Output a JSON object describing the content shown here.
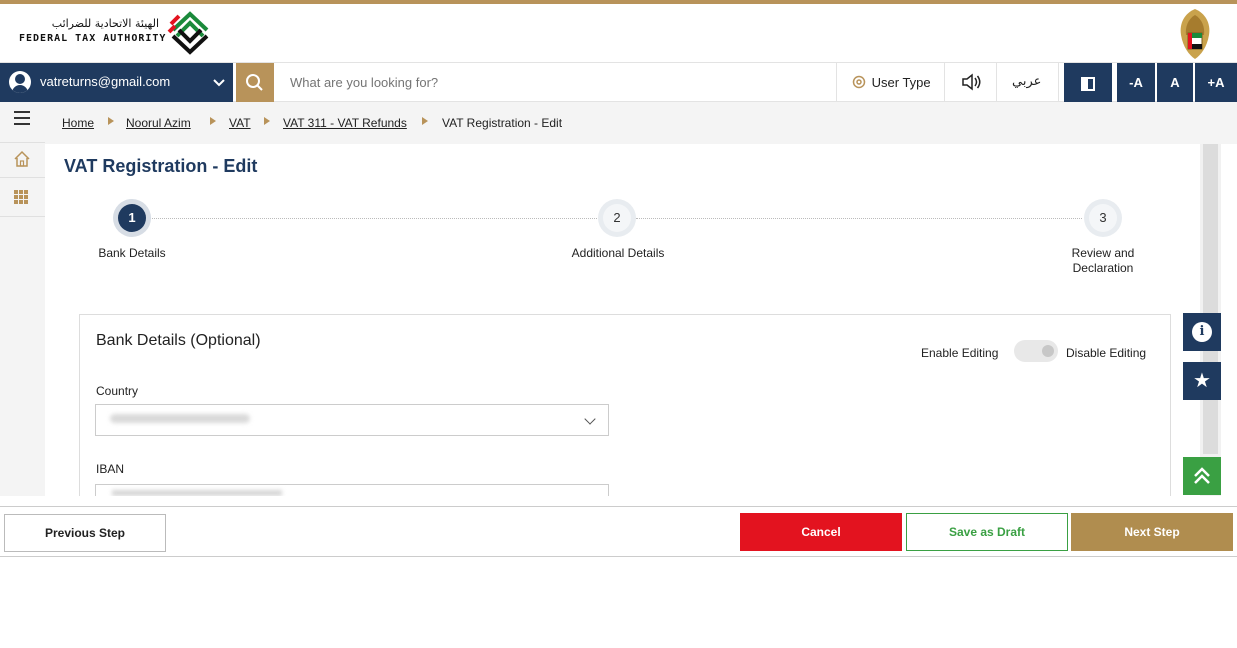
{
  "header": {
    "org_name_ar": "الهيئة الاتحادية للضرائب",
    "org_name_en": "FEDERAL TAX AUTHORITY",
    "logo_icon": "fta-logo-icon",
    "emblem_icon": "uae-emblem-icon"
  },
  "navbar": {
    "user_email": "vatreturns@gmail.com",
    "search_placeholder": "What are you looking for?",
    "user_type_label": "User Type",
    "arabic_label": "عربي",
    "decrease_font": "-A",
    "normal_font": "A",
    "increase_font": "+A"
  },
  "breadcrumb": {
    "items": [
      {
        "label": "Home"
      },
      {
        "label": "Noorul Azim"
      },
      {
        "label": "VAT"
      },
      {
        "label": "VAT 311 - VAT Refunds"
      },
      {
        "label": "VAT Registration - Edit"
      }
    ]
  },
  "page": {
    "title": "VAT Registration - Edit"
  },
  "steps": [
    {
      "number": "1",
      "label": "Bank Details",
      "active": true
    },
    {
      "number": "2",
      "label": "Additional Details",
      "active": false
    },
    {
      "number": "3",
      "label": "Review and Declaration",
      "label_line1": "Review and",
      "label_line2": "Declaration",
      "active": false
    }
  ],
  "bank_details": {
    "title": "Bank Details (Optional)",
    "enable_editing": "Enable Editing",
    "disable_editing": "Disable Editing",
    "country_label": "Country",
    "iban_label": "IBAN"
  },
  "floating": {
    "info_icon": "info-icon",
    "star_icon": "star-icon",
    "top_icon": "double-chevron-up-icon"
  },
  "footer": {
    "previous_step": "Previous Step",
    "cancel": "Cancel",
    "save_draft": "Save as Draft",
    "next_step": "Next Step"
  },
  "colors": {
    "navy": "#1f3a5f",
    "gold": "#b8935a",
    "red": "#e3131f",
    "green": "#3aa043"
  }
}
